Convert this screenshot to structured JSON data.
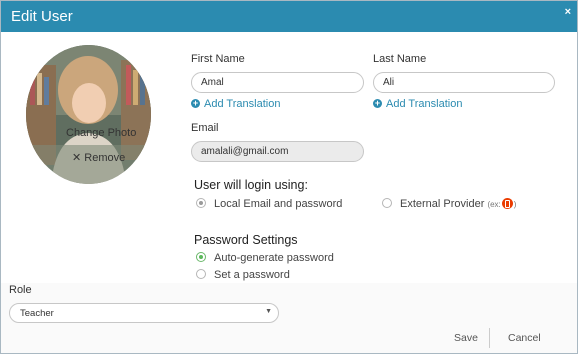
{
  "dialog": {
    "title": "Edit User",
    "close_glyph": "×"
  },
  "photo": {
    "change_label": "Change Photo",
    "remove_label": "Remove",
    "remove_icon": "close-icon"
  },
  "form": {
    "first_name": {
      "label": "First Name",
      "value": "Amal"
    },
    "last_name": {
      "label": "Last Name",
      "value": "Ali"
    },
    "add_translation_label": "Add Translation",
    "email": {
      "label": "Email",
      "value": "amalali@gmail.com"
    }
  },
  "login": {
    "heading": "User will login using:",
    "options": [
      {
        "label": "Local Email and password",
        "selected": true
      },
      {
        "label": "External Provider",
        "hint_prefix": "(ex:",
        "hint_suffix": ")",
        "icon": "office-icon",
        "selected": false
      }
    ]
  },
  "password": {
    "heading": "Password Settings",
    "options": [
      {
        "label": "Auto-generate password",
        "selected": true
      },
      {
        "label": "Set a password",
        "selected": false
      }
    ]
  },
  "role": {
    "label": "Role",
    "value": "Teacher"
  },
  "footer": {
    "save_label": "Save",
    "cancel_label": "Cancel"
  },
  "colors": {
    "titlebar": "#2b8bb0",
    "link": "#2b8bb0",
    "radio_green": "#5cb85c",
    "office": "#eb3c00"
  }
}
